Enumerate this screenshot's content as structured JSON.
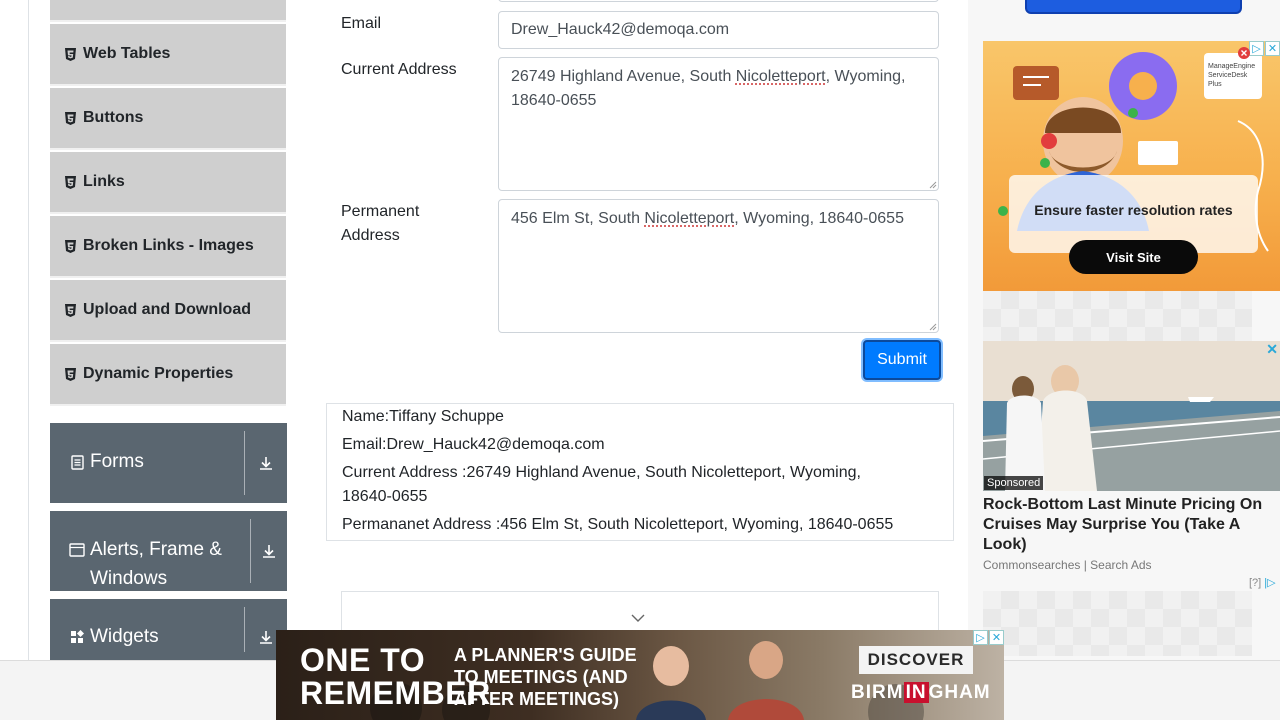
{
  "sidebar": {
    "elements": [
      {
        "label": ""
      },
      {
        "label": "Web Tables"
      },
      {
        "label": "Buttons"
      },
      {
        "label": "Links"
      },
      {
        "label": "Broken Links - Images"
      },
      {
        "label": "Upload and Download"
      },
      {
        "label": "Dynamic Properties"
      }
    ],
    "groups": [
      {
        "label": "Forms",
        "icon": "form-icon"
      },
      {
        "label": "Alerts, Frame & Windows",
        "icon": "window-icon"
      },
      {
        "label": "Widgets",
        "icon": "widgets-icon"
      }
    ]
  },
  "form": {
    "email_label": "Email",
    "email_value": "Drew_Hauck42@demoqa.com",
    "current_address_label": "Current Address",
    "current_address_part1": "26749 Highland Avenue, South ",
    "current_address_misspelled": "Nicoletteport",
    "current_address_part2": ", Wyoming, 18640-0655",
    "permanent_address_label": "Permanent Address",
    "permanent_address_part1": "456 Elm St, South ",
    "permanent_address_misspelled": "Nicoletteport",
    "permanent_address_part2": ", Wyoming, 18640-0655",
    "submit_label": "Submit"
  },
  "output": {
    "name": "Name:Tiffany Schuppe",
    "email": "Email:Drew_Hauck42@demoqa.com",
    "current_address": "Current Address :26749 Highland Avenue, South Nicoletteport, Wyoming, 18640-0655",
    "permanent_address": "Permananet Address :456 Elm St, South Nicoletteport, Wyoming, 18640-0655"
  },
  "ads": {
    "servicedesk": {
      "brand": "ManageEngine ServiceDesk Plus",
      "tagline": "Ensure faster resolution rates",
      "cta": "Visit Site"
    },
    "cruise": {
      "sponsored": "Sponsored",
      "title": "Rock-Bottom Last Minute Pricing On Cruises May Surprise You (Take A Look)",
      "source": "Commonsearches | Search Ads",
      "info_mark": "[?]"
    },
    "banner": {
      "headline_line1": "ONE TO",
      "headline_line2": "REMEMBER",
      "guide_line1": "A PLANNER'S GUIDE",
      "guide_line2": "TO MEETINGS (AND",
      "guide_line3": "AFTER MEETINGS)",
      "cta": "DISCOVER",
      "city_pre": "BIRM",
      "city_in": "IN",
      "city_post": "GHAM"
    }
  },
  "colors": {
    "primary": "#007bff",
    "sidebar_item_bg": "#cfcfcf",
    "group_bg": "#5a6670"
  }
}
